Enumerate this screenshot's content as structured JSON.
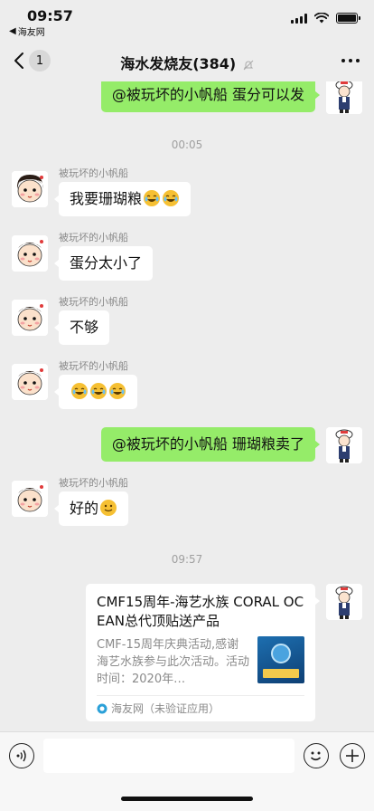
{
  "status_bar": {
    "time": "09:57",
    "back_app": "海友网",
    "back_arrow": "◀"
  },
  "nav": {
    "unread_count": "1",
    "title": "海水发烧友(384)"
  },
  "messages": [
    {
      "id": "m0",
      "side": "right",
      "text": "@被玩坏的小帆船 蛋分可以发"
    },
    {
      "id": "t1",
      "type": "time",
      "text": "00:05"
    },
    {
      "id": "m1",
      "side": "left",
      "name": "被玩坏的小帆船",
      "text": "我要珊瑚粮",
      "emoji_count": 2,
      "emoji": "laugh-cry"
    },
    {
      "id": "m2",
      "side": "left",
      "name": "被玩坏的小帆船",
      "text": "蛋分太小了"
    },
    {
      "id": "m3",
      "side": "left",
      "name": "被玩坏的小帆船",
      "text": "不够"
    },
    {
      "id": "m4",
      "side": "left",
      "name": "被玩坏的小帆船",
      "text": "",
      "emoji_count": 3,
      "emoji": "laugh-cry"
    },
    {
      "id": "m5",
      "side": "right",
      "text": "@被玩坏的小帆船 珊瑚粮卖了"
    },
    {
      "id": "m6",
      "side": "left",
      "name": "被玩坏的小帆船",
      "text": "好的",
      "emoji_count": 1,
      "emoji": "smile"
    },
    {
      "id": "t2",
      "type": "time",
      "text": "09:57"
    }
  ],
  "link_card": {
    "title": "CMF15周年-海艺水族 CORAL OCEAN总代顶贴送产品",
    "description": "CMF-15周年庆典活动,感谢海艺水族参与此次活动。活动时间：2020年…",
    "source": "海友网（未验证应用）",
    "thumb_label": "thumbnail"
  },
  "colors": {
    "sent_bubble": "#95ec69",
    "background": "#ededed",
    "received_bubble": "#ffffff"
  },
  "icons": [
    "back-chevron-icon",
    "mute-icon",
    "more-icon",
    "voice-icon",
    "emoji-icon",
    "plus-icon",
    "wifi-icon",
    "battery-icon",
    "signal-icon"
  ]
}
